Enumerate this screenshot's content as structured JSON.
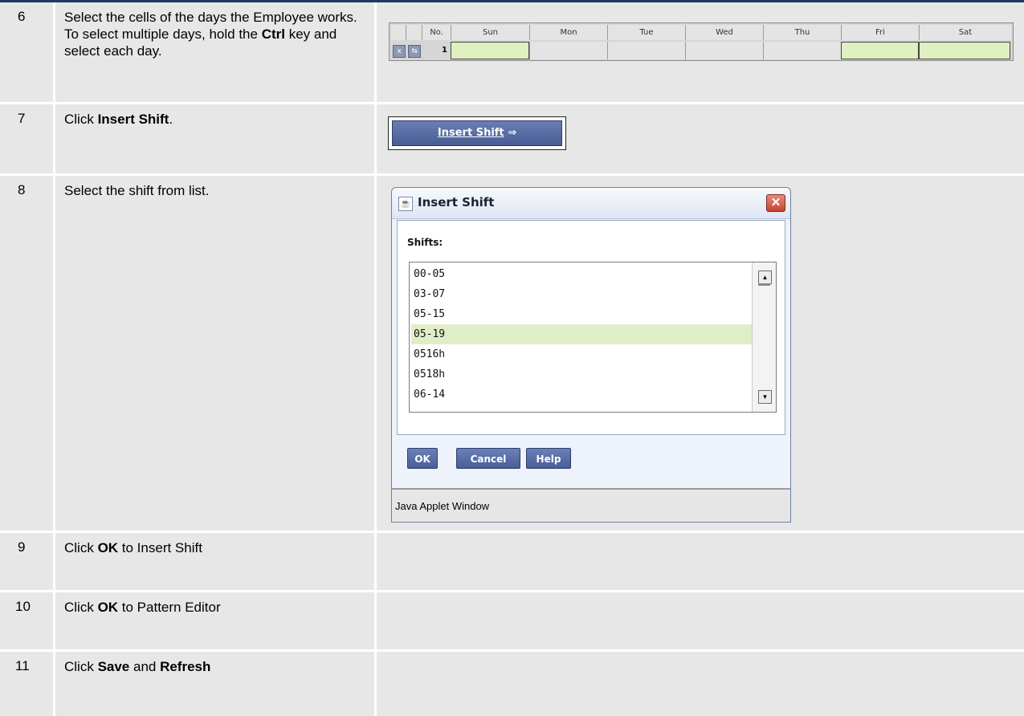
{
  "steps": [
    {
      "number": "6",
      "parts": [
        "Select the cells of the days the Employee works. To select multiple days, hold the ",
        "Ctrl",
        " key and select each day."
      ]
    },
    {
      "number": "7",
      "parts": [
        "Click ",
        "Insert Shift",
        "."
      ]
    },
    {
      "number": "8",
      "parts": [
        "Select the shift from list."
      ]
    },
    {
      "number": "9",
      "parts": [
        "Click ",
        "OK",
        " to Insert Shift"
      ]
    },
    {
      "number": "10",
      "parts": [
        "Click ",
        "OK",
        " to Pattern Editor"
      ]
    },
    {
      "number": "11",
      "parts": [
        "Click ",
        "Save",
        " and ",
        "Refresh"
      ]
    }
  ],
  "pattern_grid": {
    "headers": [
      "No.",
      "Sun",
      "Mon",
      "Tue",
      "Wed",
      "Thu",
      "Fri",
      "Sat"
    ],
    "row_number": "1",
    "selected_days": [
      "Sun",
      "Fri",
      "Sat"
    ],
    "delete_button": "x",
    "move_button": "⇆"
  },
  "insert_shift_button": {
    "label": "Insert Shift",
    "arrow": "⇒"
  },
  "dialog": {
    "title": "Insert Shift",
    "icon": "java-icon",
    "close_glyph": "✕",
    "shifts_label": "Shifts:",
    "items": [
      "00-05",
      "03-07",
      "05-15",
      "05-19",
      "0516h",
      "0518h",
      "06-14"
    ],
    "selected_item": "05-19",
    "buttons": {
      "ok": "OK",
      "cancel": "Cancel",
      "help": "Help"
    },
    "status": "Java Applet Window"
  },
  "colors": {
    "row_bg": "#e7e7e7",
    "selected_cell": "#e0f0c0",
    "button_blue": "#485e97"
  }
}
